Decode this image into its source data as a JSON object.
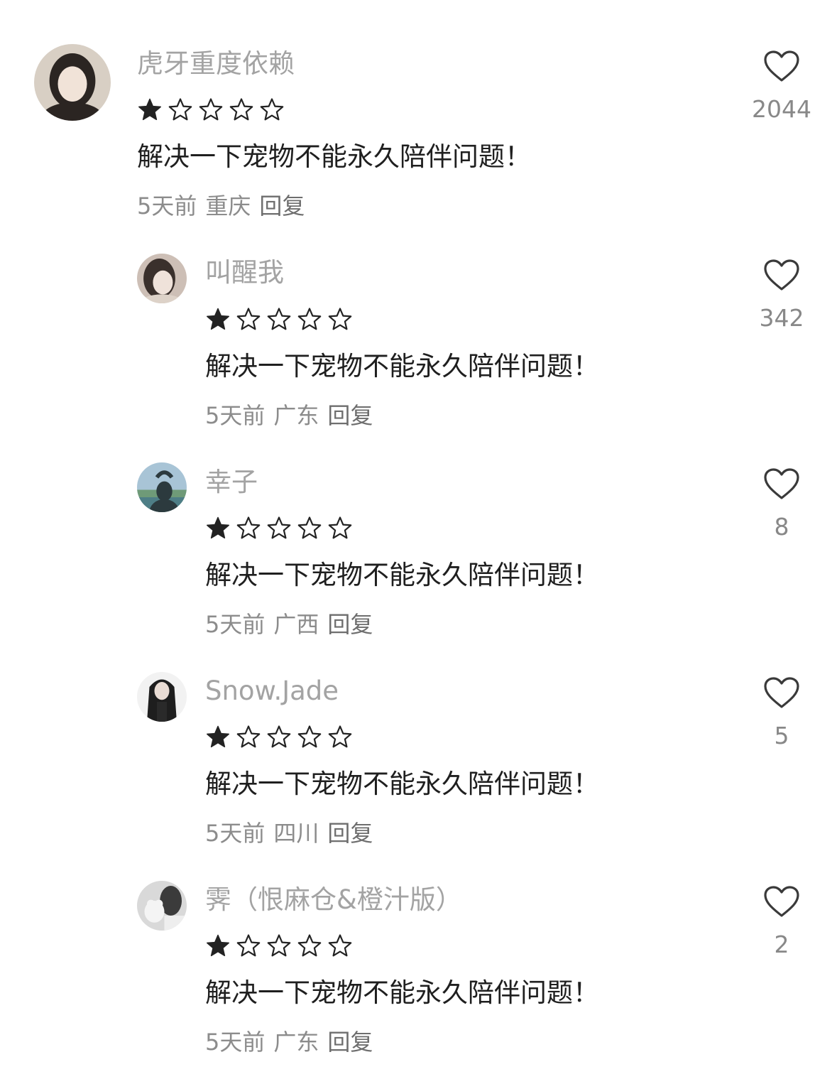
{
  "comments": [
    {
      "username": "虎牙重度依赖",
      "rating": 1,
      "text": "解决一下宠物不能永久陪伴问题！",
      "time": "5天前",
      "location": "重庆",
      "reply_label": "回复",
      "likes": "2044",
      "avatar_colors": [
        "#d8cfc4",
        "#2b2522",
        "#f1e3d8"
      ]
    },
    {
      "username": "叫醒我",
      "rating": 1,
      "text": "解决一下宠物不能永久陪伴问题！",
      "time": "5天前",
      "location": "广东",
      "reply_label": "回复",
      "likes": "342",
      "avatar_colors": [
        "#cdbfb6",
        "#3a302c",
        "#efe2da"
      ]
    },
    {
      "username": "幸子",
      "rating": 1,
      "text": "解决一下宠物不能永久陪伴问题！",
      "time": "5天前",
      "location": "广西",
      "reply_label": "回复",
      "likes": "8",
      "avatar_colors": [
        "#a8c4d6",
        "#2c3a3e",
        "#6f9a78"
      ]
    },
    {
      "username": "Snow.Jade",
      "rating": 1,
      "text": "解决一下宠物不能永久陪伴问题！",
      "time": "5天前",
      "location": "四川",
      "reply_label": "回复",
      "likes": "5",
      "avatar_colors": [
        "#f2f2f2",
        "#1e1e1e",
        "#e9dcd4"
      ]
    },
    {
      "username": "霁（恨麻仓&橙汁版）",
      "rating": 1,
      "text": "解决一下宠物不能永久陪伴问题！",
      "time": "5天前",
      "location": "广东",
      "reply_label": "回复",
      "likes": "2",
      "avatar_colors": [
        "#d9d9d9",
        "#3b3b3b",
        "#f4f4f4"
      ]
    }
  ],
  "colors": {
    "star_filled": "#222222",
    "star_empty": "#222222",
    "heart": "#3a3a3a"
  }
}
